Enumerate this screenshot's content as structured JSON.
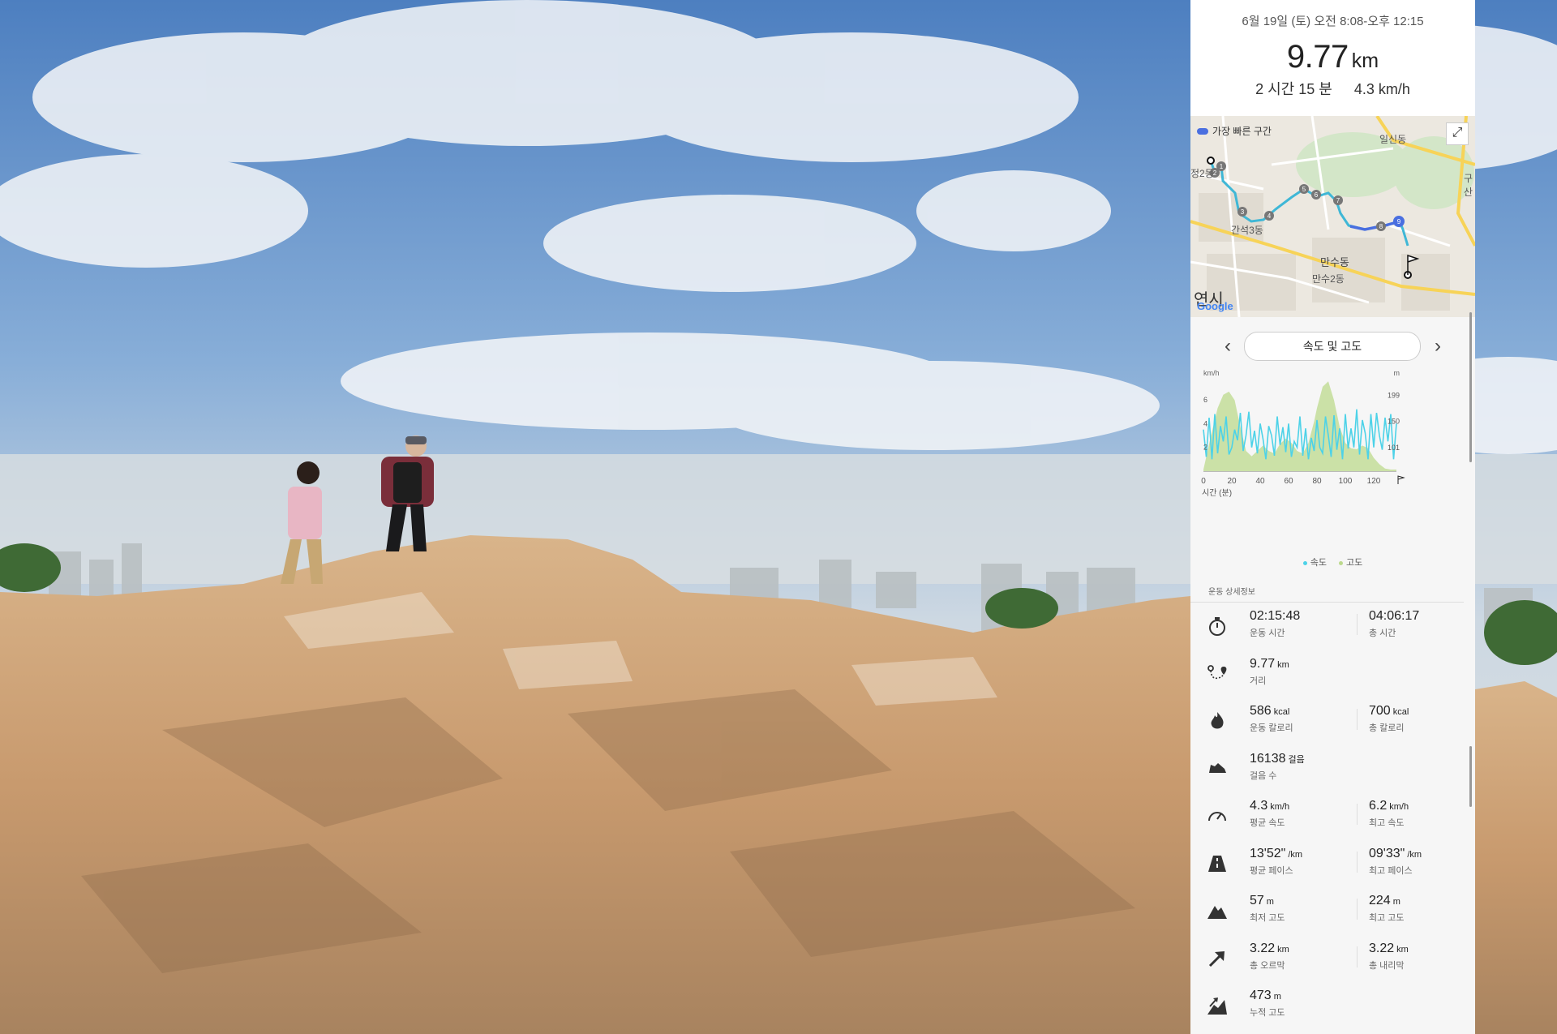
{
  "header": {
    "date_range": "6월 19일 (토) 오전 8:08-오후 12:15",
    "distance_value": "9.77",
    "distance_unit": "km",
    "duration": "2 시간 15 분",
    "avg_speed": "4.3 km/h"
  },
  "map": {
    "legend_label": "가장 빠른 구간",
    "labels": [
      "일신동",
      "간석3동",
      "만수동",
      "만수2동",
      "정2동",
      "구산",
      "연시"
    ],
    "provider": "Google",
    "waypoints": [
      "1",
      "2",
      "3",
      "4",
      "5",
      "6",
      "7",
      "8",
      "9"
    ]
  },
  "chart_nav": {
    "selected": "속도 및 고도",
    "prev_icon": "chevron-left-icon",
    "next_icon": "chevron-right-icon"
  },
  "chart_data": {
    "type": "area",
    "xlabel": "시간 (분)",
    "y_left_unit": "km/h",
    "y_right_unit": "m",
    "x_ticks": [
      "0",
      "20",
      "40",
      "60",
      "80",
      "100",
      "120"
    ],
    "y_left_ticks": [
      "2",
      "4",
      "6"
    ],
    "y_right_ticks": [
      "101",
      "150",
      "199"
    ],
    "xlim": [
      0,
      136
    ],
    "ylim_left": [
      0,
      7.5
    ],
    "ylim_right": [
      57,
      224
    ],
    "grid": false,
    "legend_position": "bottom",
    "series": [
      {
        "name": "속도",
        "color": "#4dd2e8",
        "axis": "left",
        "x": [
          0,
          2,
          4,
          6,
          8,
          10,
          12,
          14,
          16,
          18,
          20,
          22,
          24,
          26,
          28,
          30,
          32,
          34,
          36,
          38,
          40,
          42,
          44,
          46,
          48,
          50,
          52,
          54,
          56,
          58,
          60,
          62,
          64,
          66,
          68,
          70,
          72,
          74,
          76,
          78,
          80,
          82,
          84,
          86,
          88,
          90,
          92,
          94,
          96,
          98,
          100,
          102,
          104,
          106,
          108,
          110,
          112,
          114,
          116,
          118,
          120,
          122,
          124,
          126,
          128,
          130,
          132,
          134,
          136
        ],
        "values": [
          3.5,
          1.2,
          4.5,
          1.0,
          4.8,
          1.5,
          3.8,
          2.5,
          4.6,
          1.4,
          2.0,
          3.5,
          2.6,
          4.9,
          1.7,
          3.0,
          5.0,
          2.0,
          3.4,
          1.5,
          4.0,
          2.7,
          1.0,
          3.8,
          3.0,
          1.3,
          4.6,
          2.2,
          3.7,
          1.6,
          4.0,
          1.2,
          2.5,
          2.0,
          4.6,
          1.3,
          3.6,
          1.0,
          2.8,
          1.7,
          4.3,
          2.0,
          1.5,
          4.6,
          3.0,
          1.2,
          4.7,
          1.8,
          3.6,
          1.0,
          4.8,
          1.9,
          3.6,
          2.0,
          5.2,
          1.4,
          4.3,
          3.2,
          1.0,
          4.8,
          2.0,
          4.9,
          3.0,
          1.8,
          4.5,
          2.5,
          4.8,
          1.0,
          4.0
        ]
      },
      {
        "name": "고도",
        "color": "#bcd98c",
        "axis": "right",
        "x": [
          0,
          5,
          10,
          14,
          18,
          22,
          26,
          30,
          34,
          38,
          42,
          46,
          50,
          54,
          58,
          62,
          66,
          70,
          74,
          78,
          80,
          84,
          88,
          92,
          96,
          100,
          104,
          108,
          112,
          116,
          120,
          124,
          128,
          132,
          136
        ],
        "values": [
          60,
          120,
          175,
          200,
          206,
          190,
          140,
          95,
          85,
          95,
          105,
          95,
          90,
          108,
          118,
          110,
          95,
          90,
          110,
          150,
          175,
          215,
          225,
          190,
          140,
          110,
          100,
          98,
          105,
          100,
          82,
          70,
          62,
          60,
          60
        ]
      }
    ]
  },
  "details": {
    "title": "운동 상세정보",
    "rows": [
      {
        "icon": "stopwatch-icon",
        "a_val": "02:15:48",
        "a_unit": "",
        "a_label": "운동 시간",
        "b_val": "04:06:17",
        "b_unit": "",
        "b_label": "총 시간"
      },
      {
        "icon": "route-icon",
        "a_val": "9.77",
        "a_unit": "km",
        "a_label": "거리",
        "b_val": "",
        "b_unit": "",
        "b_label": ""
      },
      {
        "icon": "flame-icon",
        "a_val": "586",
        "a_unit": "kcal",
        "a_label": "운동 칼로리",
        "b_val": "700",
        "b_unit": "kcal",
        "b_label": "총 칼로리"
      },
      {
        "icon": "shoe-icon",
        "a_val": "16138",
        "a_unit": "걸음",
        "a_label": "걸음 수",
        "b_val": "",
        "b_unit": "",
        "b_label": ""
      },
      {
        "icon": "speedometer-icon",
        "a_val": "4.3",
        "a_unit": "km/h",
        "a_label": "평균 속도",
        "b_val": "6.2",
        "b_unit": "km/h",
        "b_label": "최고 속도"
      },
      {
        "icon": "road-icon",
        "a_val": "13'52\"",
        "a_unit": "/km",
        "a_label": "평균 페이스",
        "b_val": "09'33\"",
        "b_unit": "/km",
        "b_label": "최고 페이스"
      },
      {
        "icon": "mountain-icon",
        "a_val": "57",
        "a_unit": "m",
        "a_label": "최저 고도",
        "b_val": "224",
        "b_unit": "m",
        "b_label": "최고 고도"
      },
      {
        "icon": "arrow-up-right-icon",
        "a_val": "3.22",
        "a_unit": "km",
        "a_label": "총 오르막",
        "b_val": "3.22",
        "b_unit": "km",
        "b_label": "총 내리막"
      },
      {
        "icon": "climb-icon",
        "a_val": "473",
        "a_unit": "m",
        "a_label": "누적 고도",
        "b_val": "",
        "b_unit": "",
        "b_label": ""
      }
    ]
  },
  "colors": {
    "speed": "#4dd2e8",
    "altitude": "#bcd98c",
    "route": "#3fb7d6",
    "fastest": "#4a6fe0"
  }
}
